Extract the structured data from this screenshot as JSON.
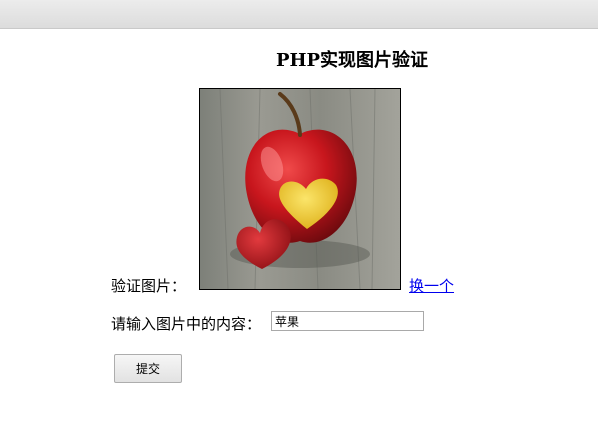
{
  "page": {
    "title": "PHP实现图片验证"
  },
  "captcha": {
    "label": "验证图片：",
    "image_icon": "apple-heart-image",
    "refresh_label": "换一个"
  },
  "answer": {
    "label": "请输入图片中的内容：",
    "value": "苹果"
  },
  "form": {
    "submit_label": "提交"
  },
  "colors": {
    "link": "#0000ee",
    "apple_red": "#c8161d",
    "heart_yellow": "#f2d23a",
    "wood": "#8a8a80"
  }
}
